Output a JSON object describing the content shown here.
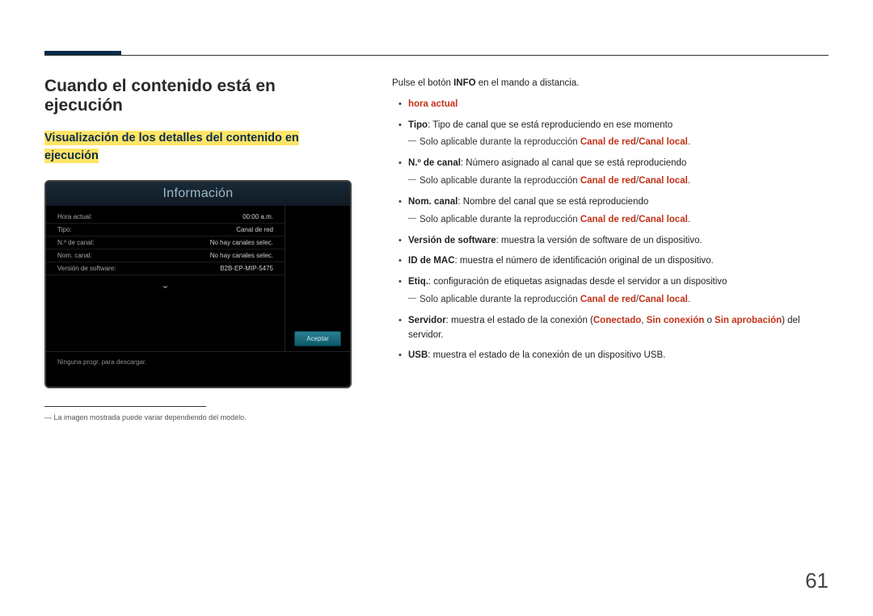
{
  "page_number": "61",
  "heading": "Cuando el contenido está en ejecución",
  "subheading": "Visualización de los detalles del contenido en ejecución",
  "info_panel": {
    "title": "Información",
    "rows": [
      {
        "label": "Hora actual:",
        "value": "00:00 a.m."
      },
      {
        "label": "Tipo:",
        "value": "Canal de red"
      },
      {
        "label": "N.º de canal:",
        "value": "No hay canales selec."
      },
      {
        "label": "Nom. canal:",
        "value": "No hay canales selec."
      },
      {
        "label": "Versión de software:",
        "value": "B2B-EP-MIP-5475"
      }
    ],
    "footer_text": "Ninguna progr. para descargar.",
    "accept_button": "Aceptar"
  },
  "footnote": "La imagen mostrada puede variar dependiendo del modelo.",
  "intro_pre": "Pulse el botón ",
  "intro_bold": "INFO",
  "intro_post": " en el mando a distancia.",
  "items": {
    "hora_actual": "hora actual",
    "tipo_label": "Tipo",
    "tipo_text": ": Tipo de canal que se está reproduciendo en ese momento",
    "sub_aplicable_pre": "Solo aplicable durante la reproducción ",
    "canal_red": "Canal de red",
    "slash": "/",
    "canal_local": "Canal local",
    "punto": ".",
    "ncanal_label": "N.º de canal",
    "ncanal_text": ": Número asignado al canal que se está reproduciendo",
    "nomcanal_label": "Nom. canal",
    "nomcanal_text": ": Nombre del canal que se está reproduciendo",
    "version_label": "Versión de software",
    "version_text": ": muestra la versión de software de un dispositivo.",
    "mac_label": "ID de MAC",
    "mac_text": ": muestra el número de identificación original de un dispositivo.",
    "etiq_label": "Etiq.",
    "etiq_text": ": configuración de etiquetas asignadas desde el servidor a un dispositivo",
    "servidor_label": "Servidor",
    "servidor_pre": ": muestra el estado de la conexión (",
    "conectado": "Conectado",
    "coma": ", ",
    "sin_conexion": "Sin conexión",
    "o": " o ",
    "sin_aprob": "Sin aprobación",
    "servidor_post": ") del servidor.",
    "usb_label": "USB",
    "usb_text": ": muestra el estado de la conexión de un dispositivo USB."
  }
}
